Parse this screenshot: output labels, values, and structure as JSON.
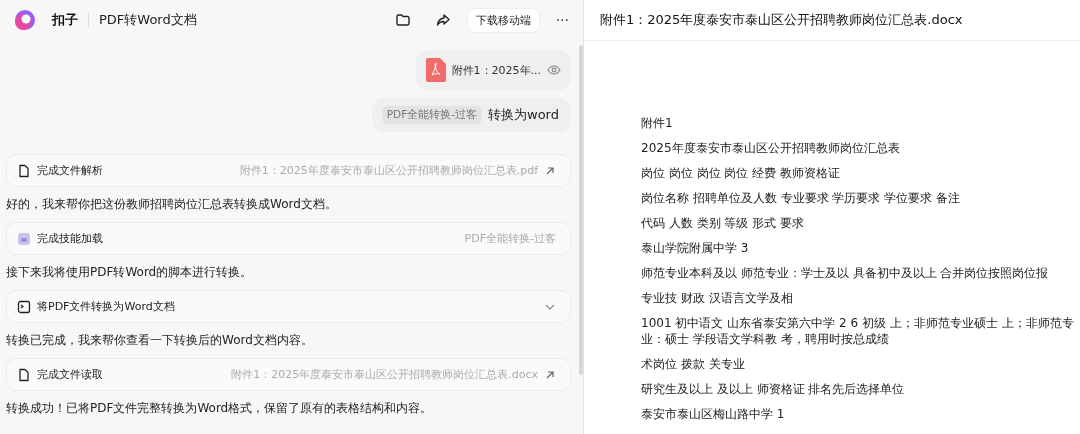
{
  "app": {
    "name": "扣子",
    "title": "PDF转Word文档",
    "download_button": "下载移动端",
    "more": "···"
  },
  "messages": [
    {
      "kind": "file",
      "name": "附件1：2025年..."
    },
    {
      "kind": "prompt",
      "tag": "PDF全能转换-过客",
      "text": "转换为word"
    },
    {
      "kind": "file_step",
      "label": "完成文件解析",
      "detail": "附件1：2025年度泰安市泰山区公开招聘教师岗位汇总表.pdf"
    },
    {
      "kind": "text",
      "text": "好的，我来帮你把这份教师招聘岗位汇总表转换成Word文档。"
    },
    {
      "kind": "skill_step",
      "label": "完成技能加载",
      "detail": "PDF全能转换-过客"
    },
    {
      "kind": "text",
      "text": "接下来我将使用PDF转Word的脚本进行转换。"
    },
    {
      "kind": "tool_step",
      "label": "将PDF文件转换为Word文档",
      "expanded": false
    },
    {
      "kind": "text",
      "text": "转换已完成，我来帮你查看一下转换后的Word文档内容。"
    },
    {
      "kind": "file_step",
      "label": "完成文件读取",
      "detail": "附件1：2025年度泰安市泰山区公开招聘教师岗位汇总表.docx"
    },
    {
      "kind": "text",
      "text": "转换成功！已将PDF文件完整转换为Word格式，保留了原有的表格结构和内容。"
    }
  ],
  "preview": {
    "title": "附件1：2025年度泰安市泰山区公开招聘教师岗位汇总表.docx",
    "lines": [
      "附件1",
      "2025年度泰安市泰山区公开招聘教师岗位汇总表",
      "岗位 岗位 岗位 岗位 经费 教师资格证",
      "岗位名称 招聘单位及人数 专业要求 学历要求 学位要求 备注",
      "代码 人数 类别 等级 形式 要求",
      "泰山学院附属中学 3",
      "师范专业本科及以 师范专业：学士及以 具备初中及以上 合并岗位按照岗位报",
      "专业技 财政 汉语言文学及相",
      "1001 初中语文 山东省泰安第六中学 2 6 初级 上；非师范专业硕士 上；非师范专业：硕士 学段语文学科教 考，聘用时按总成绩",
      "术岗位 拨款 关专业",
      "研究生及以上 及以上 师资格证 排名先后选择单位",
      "泰安市泰山区梅山路中学 1"
    ]
  }
}
